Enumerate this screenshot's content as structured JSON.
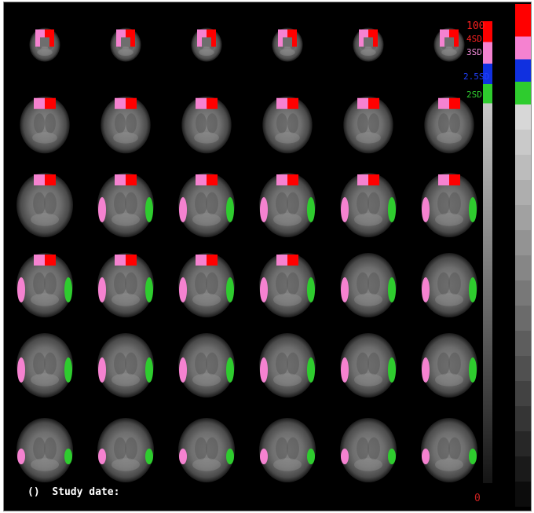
{
  "viewer": {
    "grid": {
      "rows": 6,
      "columns": 6
    },
    "legend": {
      "max_label": "100",
      "sd_labels": [
        {
          "text": "4SD",
          "color": "#ff2020"
        },
        {
          "text": "3SD",
          "color": "#f08ad8"
        },
        {
          "text": "2.5SD",
          "color": "#2040ff"
        },
        {
          "text": "2SD",
          "color": "#30d030"
        }
      ],
      "min_label": "0"
    },
    "colors": {
      "max_label": "#ff2020",
      "min_label": "#cc2020",
      "sd4": "#ff0000",
      "sd3": "#f582d0",
      "sd25": "#1030e0",
      "sd2": "#2ecc2e"
    },
    "footer": {
      "parens": "()",
      "study_date_label": "Study date:"
    }
  }
}
